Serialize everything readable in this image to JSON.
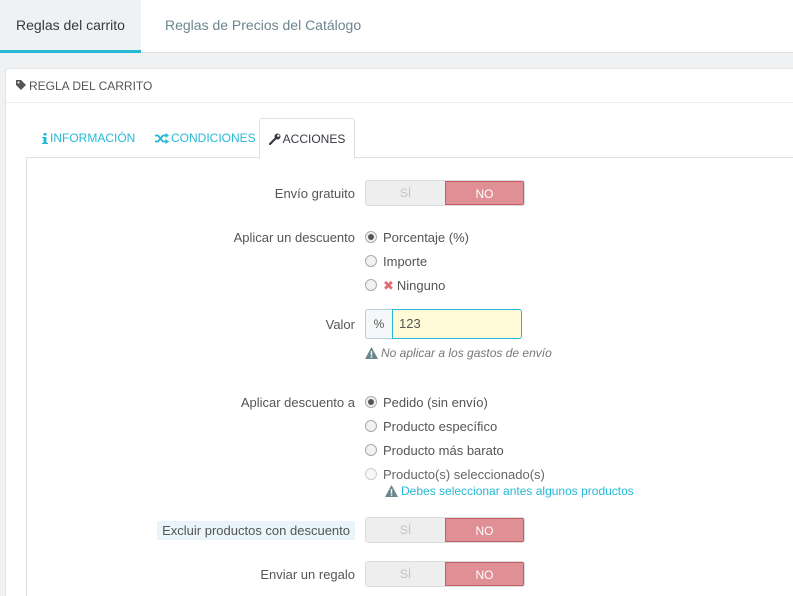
{
  "top_tabs": {
    "active": "Reglas del carrito",
    "inactive": "Reglas de Precios del Catálogo"
  },
  "panel": {
    "heading": "REGLA DEL CARRITO"
  },
  "sub_tabs": {
    "info": "INFORMACIÓN",
    "conditions": "CONDICIONES",
    "actions": "ACCIONES"
  },
  "form": {
    "free_shipping": {
      "label": "Envío gratuito",
      "yes": "SÍ",
      "no": "NO",
      "value": "NO"
    },
    "apply_discount": {
      "label": "Aplicar un descuento",
      "options": [
        "Porcentaje (%)",
        "Importe",
        "Ninguno"
      ],
      "selected": "Porcentaje (%)"
    },
    "value": {
      "label": "Valor",
      "addon": "%",
      "input": "123",
      "help": "No aplicar a los gastos de envío"
    },
    "apply_to": {
      "label": "Aplicar descuento a",
      "options": [
        "Pedido (sin envío)",
        "Producto específico",
        "Producto más barato",
        "Producto(s) seleccionado(s)"
      ],
      "selected": "Pedido (sin envío)",
      "warning": "Debes seleccionar antes algunos productos"
    },
    "exclude_discounted": {
      "label": "Excluir productos con descuento",
      "yes": "SÍ",
      "no": "NO",
      "value": "NO"
    },
    "send_gift": {
      "label": "Enviar un regalo",
      "yes": "SÍ",
      "no": "NO",
      "value": "NO"
    }
  },
  "colors": {
    "accent": "#25b9d7",
    "no_active": "#e08f95",
    "input_bg": "#fffbd9"
  }
}
